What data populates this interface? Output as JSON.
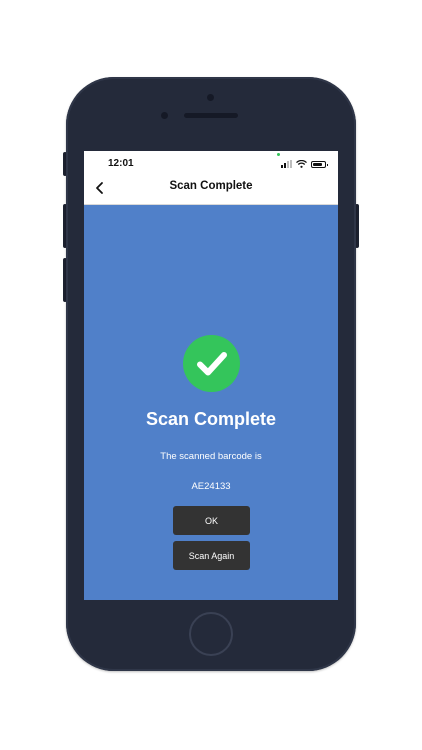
{
  "status_bar": {
    "time": "12:01",
    "icons": [
      "signal-icon",
      "wifi-icon",
      "battery-icon"
    ]
  },
  "nav": {
    "back_icon": "chevron-left-icon",
    "title": "Scan Complete"
  },
  "result": {
    "icon": "checkmark-circle-icon",
    "heading": "Scan Complete",
    "message": "The scanned barcode is",
    "barcode": "AE24133"
  },
  "actions": {
    "ok_label": "OK",
    "scan_again_label": "Scan Again"
  },
  "colors": {
    "screen_background": "#5080c9",
    "success_green": "#34c55b",
    "button_background": "#333333",
    "device_body": "#242a3a"
  }
}
